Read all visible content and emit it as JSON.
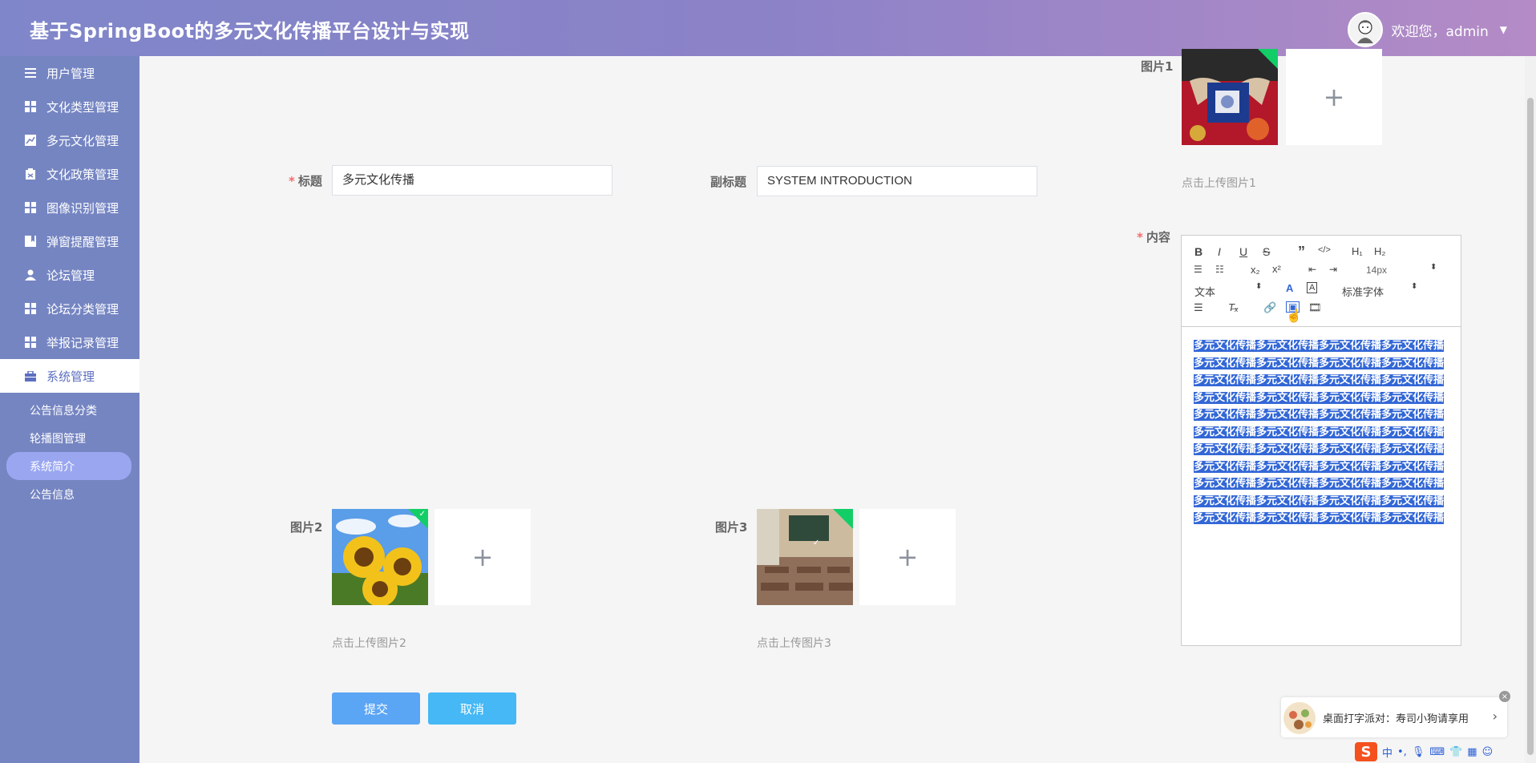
{
  "header": {
    "title": "基于SpringBoot的多元文化传播平台设计与实现",
    "welcome": "欢迎您，admin"
  },
  "sidebar": {
    "items": [
      {
        "label": "用户管理",
        "icon": "list-icon"
      },
      {
        "label": "文化类型管理",
        "icon": "grid-icon"
      },
      {
        "label": "多元文化管理",
        "icon": "chart-icon"
      },
      {
        "label": "文化政策管理",
        "icon": "clipboard-icon"
      },
      {
        "label": "图像识别管理",
        "icon": "grid-icon"
      },
      {
        "label": "弹窗提醒管理",
        "icon": "bookmark-icon"
      },
      {
        "label": "论坛管理",
        "icon": "user-icon"
      },
      {
        "label": "论坛分类管理",
        "icon": "grid-icon"
      },
      {
        "label": "举报记录管理",
        "icon": "grid-icon"
      },
      {
        "label": "系统管理",
        "icon": "briefcase-icon"
      }
    ],
    "sub_items": [
      {
        "label": "公告信息分类"
      },
      {
        "label": "轮播图管理"
      },
      {
        "label": "系统简介"
      },
      {
        "label": "公告信息"
      }
    ]
  },
  "form": {
    "title_label": "标题",
    "title_value": "多元文化传播",
    "subtitle_label": "副标题",
    "subtitle_value": "SYSTEM INTRODUCTION",
    "image1_label": "图片1",
    "image1_tip": "点击上传图片1",
    "image2_label": "图片2",
    "image2_tip": "点击上传图片2",
    "image3_label": "图片3",
    "image3_tip": "点击上传图片3",
    "content_label": "内容",
    "content_text": "多元文化传播多元文化传播多元文化传播多元文化传播多元文化传播多元文化传播多元文化传播多元文化传播多元文化传播多元文化传播多元文化传播多元文化传播多元文化传播多元文化传播多元文化传播多元文化传播多元文化传播多元文化传播多元文化传播多元文化传播多元文化传播多元文化传播多元文化传播多元文化传播多元文化传播多元文化传播多元文化传播多元文化传播多元文化传播多元文化传播多元文化传播多元文化传播多元文化传播多元文化传播多元文化传播多元文化传播多元文化传播多元文化传播多元文化传播多元文化传播多元文化传播多元文化传播多元文化传播多元文化传播",
    "submit_label": "提交",
    "cancel_label": "取消"
  },
  "editor_toolbar": {
    "font_size": "14px",
    "format": "文本",
    "font_family": "标准字体"
  },
  "ime": {
    "popup_text": "桌面打字派对：寿司小狗请享用",
    "bar_lang": "中"
  },
  "colors": {
    "sidebar": "#7585c2",
    "submit": "#5ba5f5",
    "cancel": "#45b8f5",
    "required": "#f56c6c",
    "selection": "#3367d6"
  }
}
